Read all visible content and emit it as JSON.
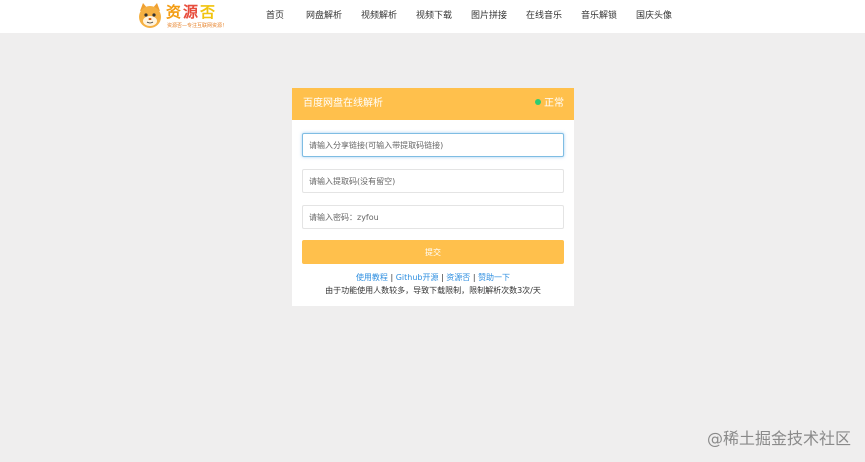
{
  "header": {
    "logo": {
      "title_1": "资",
      "title_2": "源",
      "title_3": "否",
      "tagline": "资源否—专注互联网资源！"
    },
    "nav": [
      {
        "label": "首页"
      },
      {
        "label": "网盘解析"
      },
      {
        "label": "视频解析"
      },
      {
        "label": "视频下载"
      },
      {
        "label": "图片拼接"
      },
      {
        "label": "在线音乐"
      },
      {
        "label": "音乐解锁"
      },
      {
        "label": "国庆头像"
      }
    ]
  },
  "card": {
    "title": "百度网盘在线解析",
    "status": "正常",
    "share_link_placeholder": "请输入分享链接(可输入带提取码链接)",
    "extract_code_placeholder": "请输入提取码(没有留空)",
    "password_placeholder": "请输入密码：zyfou",
    "submit_label": "提交",
    "links": {
      "tutorial": "使用教程",
      "github": "Github开源",
      "site": "资源否",
      "donate": "赞助一下",
      "separator": " | "
    },
    "note": "由于功能使用人数较多，导致下载限制，限制解析次数3次/天"
  },
  "watermark": "@稀土掘金技术社区",
  "colors": {
    "accent": "#ffc04c",
    "link": "#2f8fe0",
    "status_dot": "#2ecc71",
    "background": "#efeeee"
  }
}
